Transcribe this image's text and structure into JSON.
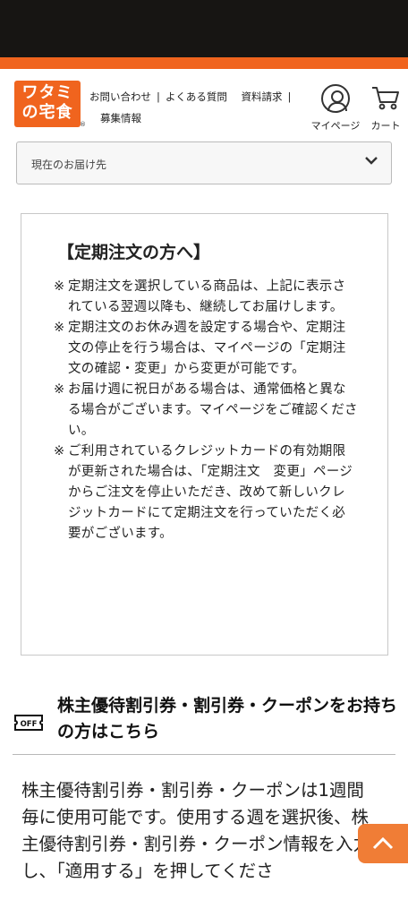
{
  "header": {
    "logo_line1": "ワタミ",
    "logo_line2": "の宅食",
    "nav": [
      "お問い合わせ",
      "よくある質問",
      "資料請求",
      "募集情報"
    ],
    "account_label": "マイページ",
    "cart_label": "カート"
  },
  "delivery": {
    "label": "現在のお届け先"
  },
  "notice": {
    "title": "【定期注文の方へ】",
    "mark": "※",
    "items": [
      "定期注文を選択している商品は、上記に表示されている翌週以降も、継続してお届けします。",
      "定期注文のお休み週を設定する場合や、定期注文の停止を行う場合は、マイページの「定期注文の確認・変更」から変更が可能です。",
      "お届け週に祝日がある場合は、通常価格と異なる場合がございます。マイページをご確認ください。",
      "ご利用されているクレジットカードの有効期限が更新された場合は、「定期注文　変更」ページからご注文を停止いただき、改めて新しいクレジットカードにて定期注文を行っていただく必要がございます。"
    ]
  },
  "coupon": {
    "icon_text": "OFF",
    "title": "株主優待割引券・割引券・クーポンをお持ちの方はこちら",
    "body": "株主優待割引券・割引券・クーポンは1週間毎に使用可能です。使用する週を選択後、株主優待割引券・割引券・クーポン情報を入力し、「適用する」を押してくださ"
  },
  "colors": {
    "brand_orange": "#f0641e",
    "status_bar": "#171513",
    "scroll_button": "#f07d36"
  }
}
